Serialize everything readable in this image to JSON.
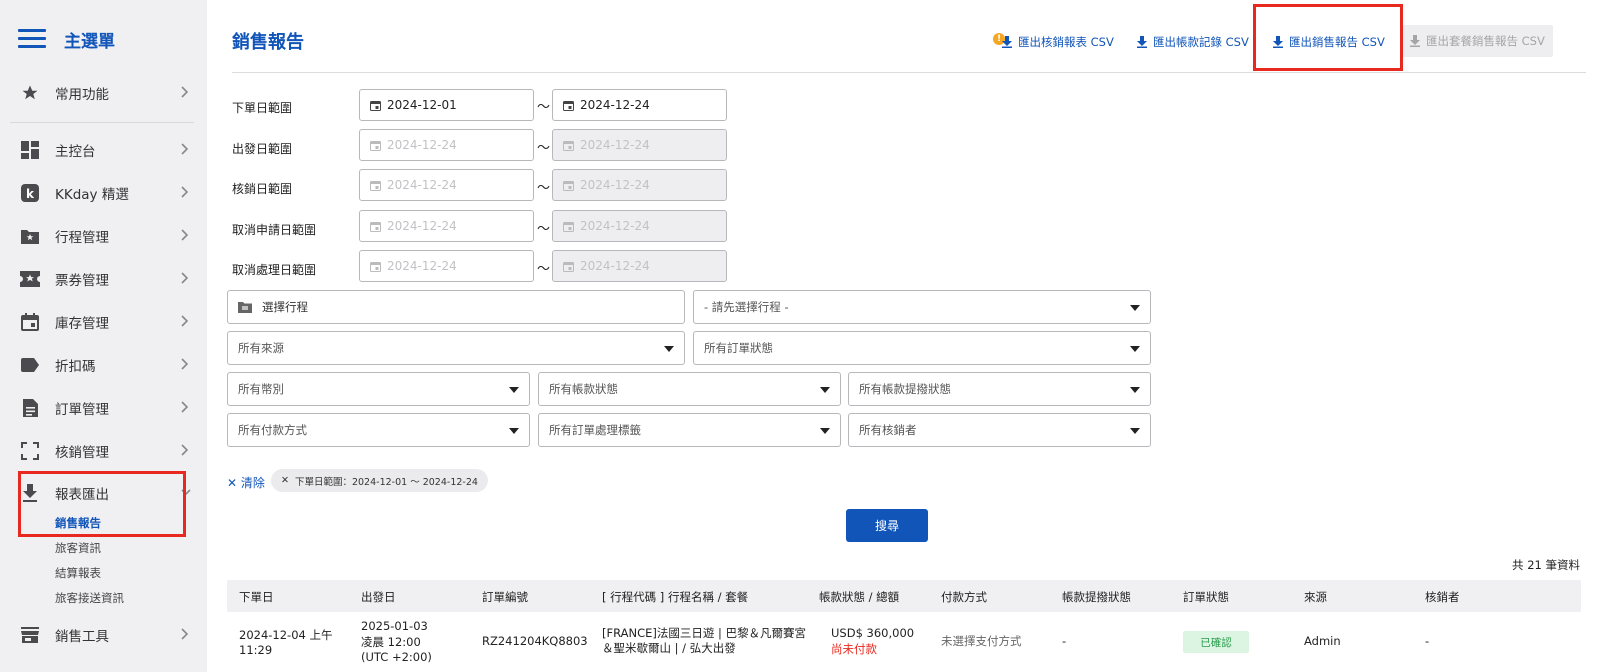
{
  "sidebar": {
    "title": "主選單",
    "items": [
      {
        "label": "常用功能",
        "icon": "star-icon"
      },
      {
        "label": "主控台",
        "icon": "dashboard-icon"
      },
      {
        "label": "KKday 精選",
        "icon": "kkday-icon"
      },
      {
        "label": "行程管理",
        "icon": "folder-star-icon"
      },
      {
        "label": "票券管理",
        "icon": "ticket-icon"
      },
      {
        "label": "庫存管理",
        "icon": "calendar-icon"
      },
      {
        "label": "折扣碼",
        "icon": "tag-icon"
      },
      {
        "label": "訂單管理",
        "icon": "document-icon"
      },
      {
        "label": "核銷管理",
        "icon": "scan-icon"
      },
      {
        "label": "報表匯出",
        "icon": "download-icon"
      },
      {
        "label": "銷售工具",
        "icon": "store-icon"
      }
    ],
    "report_subitems": [
      "銷售報告",
      "旅客資訊",
      "結算報表",
      "旅客接送資訊"
    ]
  },
  "header": {
    "title": "銷售報告",
    "exports": [
      {
        "label": "匯出核銷報表 CSV"
      },
      {
        "label": "匯出帳款記錄 CSV"
      },
      {
        "label": "匯出銷售報告 CSV"
      },
      {
        "label": "匯出套餐銷售報告 CSV"
      }
    ]
  },
  "filters": {
    "order_date": {
      "label": "下單日範圍",
      "start": "2024-12-01",
      "end": "2024-12-24"
    },
    "depart_date": {
      "label": "出發日範圍",
      "start": "2024-12-24",
      "end": "2024-12-24"
    },
    "redeem_date": {
      "label": "核銷日範圍",
      "start": "2024-12-24",
      "end": "2024-12-24"
    },
    "cancel_request_date": {
      "label": "取消申請日範圍",
      "start": "2024-12-24",
      "end": "2024-12-24"
    },
    "cancel_process_date": {
      "label": "取消處理日範圍",
      "start": "2024-12-24",
      "end": "2024-12-24"
    },
    "tilde": "～",
    "select_product": "選擇行程",
    "select_package": "- 請先選擇行程 -",
    "source": "所有來源",
    "order_status": "所有訂單狀態",
    "currency": "所有幣別",
    "payment_status": "所有帳款狀態",
    "payment_withdraw_status": "所有帳款提撥狀態",
    "payment_method": "所有付款方式",
    "order_tag": "所有訂單處理標籤",
    "redeemer": "所有核銷者"
  },
  "active_filters": {
    "clear_label": "清除",
    "chips": [
      "下單日範圍：2024-12-01 ～ 2024-12-24"
    ]
  },
  "search_label": "搜尋",
  "total_label": "共 21 筆資料",
  "table": {
    "columns": [
      "下單日",
      "出發日",
      "訂單編號",
      "[ 行程代碼 ] 行程名稱 / 套餐",
      "帳款狀態 / 總額",
      "付款方式",
      "帳款提撥狀態",
      "訂單狀態",
      "來源",
      "核銷者"
    ],
    "rows": [
      {
        "order_date": "2024-12-04 上午 11:29",
        "depart_date_1": "2025-01-03",
        "depart_date_2": "凌晨 12:00",
        "depart_date_3": "(UTC +2:00)",
        "order_no": "RZ241204KQ8803",
        "product": "[FRANCE]法國三日遊 | 巴黎＆凡爾賽宮＆聖米歇爾山 | / 弘大出發",
        "amount": "USD$ 360,000",
        "payment_status": "尚未付款",
        "payment_method": "未選擇支付方式",
        "withdraw_status": "-",
        "order_status": "已確認",
        "source": "Admin",
        "redeemer": "-"
      }
    ]
  },
  "colors": {
    "primary": "#1155b9",
    "highlight": "#e8291f",
    "unpaid": "#e8291f",
    "confirmed_bg": "#dcf5e3",
    "confirmed_text": "#2a9b4c"
  }
}
